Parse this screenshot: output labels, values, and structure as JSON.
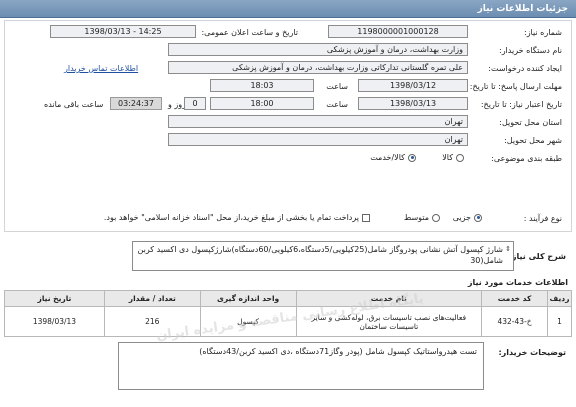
{
  "header": {
    "title": "جزئیات اطلاعات نیاز"
  },
  "form": {
    "need_number_label": "شماره نیاز:",
    "need_number": "1198000001000128",
    "announce_label": "تاریخ و ساعت اعلان عمومی:",
    "announce_value": "1398/03/13 - 14:25",
    "buyer_label": "نام دستگاه خریدار:",
    "buyer_value": "وزارت بهداشت، درمان و آموزش پزشکی",
    "creator_label": "ایجاد کننده درخواست:",
    "creator_value": "علی تمره گلستانی تدارکاتی وزارت بهداشت، درمان و آموزش پزشکی",
    "contact_link": "اطلاعات تماس خریدار",
    "send_deadline_label": "مهلت ارسال پاسخ: تا تاریخ:",
    "send_date": "1398/03/12",
    "time_label": "ساعت",
    "send_time": "18:03",
    "validity_label": "تاریخ اعتبار نیاز: تا تاریخ:",
    "validity_date": "1398/03/13",
    "validity_time": "18:00",
    "days_value": "0",
    "days_label": "روز و",
    "remaining_time": "03:24:37",
    "remaining_label": "ساعت باقی مانده",
    "province_label": "استان محل تحویل:",
    "province_value": "تهران",
    "city_label": "شهر محل تحویل:",
    "city_value": "تهران",
    "category_label": "طبقه بندی موضوعی:",
    "category_options": [
      "کالا",
      "کالا/خدمت"
    ],
    "process_label": "نوع فرآیند :",
    "process_options": [
      "جزیی",
      "متوسط"
    ],
    "payment_note": "پرداخت تمام یا بخشی از مبلغ خرید،از محل \"اسناد خزانه اسلامی\" خواهد بود."
  },
  "summary": {
    "label": "شرح کلی نیاز:",
    "text": "شارژ کپسول آتش نشانی پودروگاز شامل(25کیلویی/5دستگاه،6کیلویی/60دستگاه)شارژکپسول دی اکسید کربن شامل(30"
  },
  "services": {
    "title": "اطلاعات خدمات مورد نیاز",
    "columns": [
      "ردیف",
      "کد خدمت",
      "نام خدمت",
      "واحد اندازه گیری",
      "تعداد / مقدار",
      "تاریخ نیاز"
    ],
    "rows": [
      [
        "1",
        "خ-43-432",
        "فعالیت‌های نصب تاسیسات برق، لوله‌کشی و سایر تاسیسات ساختمان",
        "کپسول",
        "216",
        "1398/03/13"
      ]
    ]
  },
  "buyer_notes": {
    "label": "توضیحات خریدار:",
    "text": "تست هیدرواستاتیک کپسول شامل (پودر وگاز71دستگاه ،دی اکسید کربن/43دستگاه)"
  },
  "watermark": "پایگاه اطلاع رسانی مناقصه و مزایده ایران"
}
